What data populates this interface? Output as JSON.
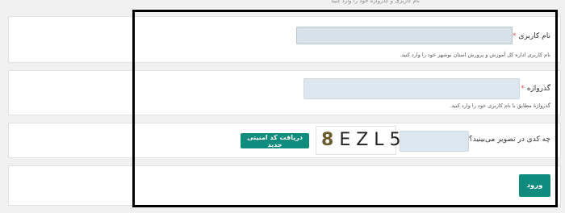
{
  "top_hint": "ﻧﺎم ﮐﺎرﺑﺮی و ﮔﺬرواژه ﺧﻮد را وارد ﮐﻨﯿﺪ",
  "username": {
    "label": "نام کاربری",
    "required_mark": "*",
    "value": "",
    "help": "نام کاربری اداره کل آموزش و پرورش استان بوشهر خود را وارد کنید."
  },
  "password": {
    "label": "گذرواژه",
    "required_mark": "*",
    "value": "",
    "help": "گذرواژهٔ مطابق با نام کاربری خود را وارد کنید."
  },
  "captcha": {
    "label": "چه کدی در تصویر می‌بینید؟",
    "required_mark": "*",
    "value": "",
    "image_first_char": "8",
    "image_rest_chars": "EZL5",
    "refresh_label": "دریافت کد امنیتی جدید"
  },
  "login_button_label": "ورود",
  "colors": {
    "accent": "#0f8c7e",
    "input_bg": "#dbe6ee",
    "required": "#d9534f",
    "page_bg": "#f1f1f1",
    "card_bg": "#ffffff"
  }
}
